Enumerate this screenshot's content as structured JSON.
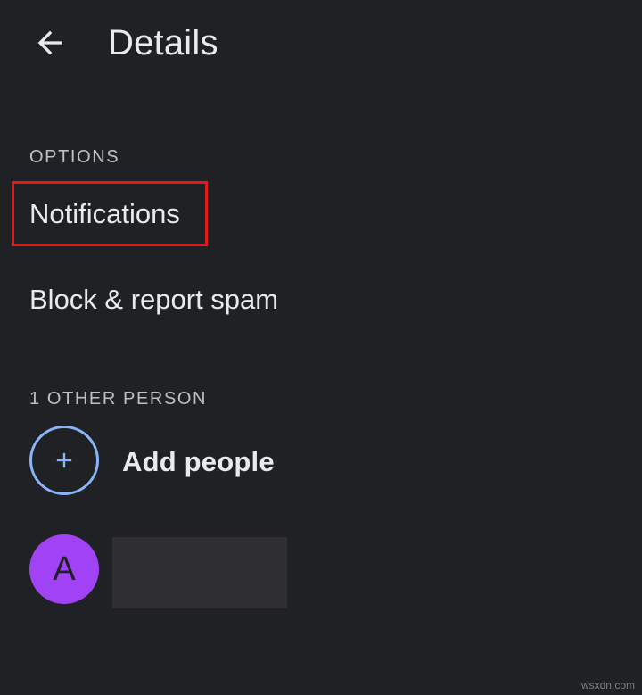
{
  "header": {
    "title": "Details",
    "back_icon": "arrow-back-icon"
  },
  "options": {
    "section_label": "OPTIONS",
    "items": [
      {
        "label": "Notifications",
        "highlighted": true
      },
      {
        "label": "Block & report spam"
      }
    ]
  },
  "people": {
    "section_label": "1 OTHER PERSON",
    "add_label": "Add people",
    "add_icon": "plus-icon",
    "person": {
      "avatar_initial": "A",
      "avatar_color": "#a142f4",
      "name_redacted": true
    }
  },
  "colors": {
    "background": "#202124",
    "accent": "#8ab4f8",
    "highlight_border": "#e21a1a"
  },
  "watermark": "wsxdn.com"
}
